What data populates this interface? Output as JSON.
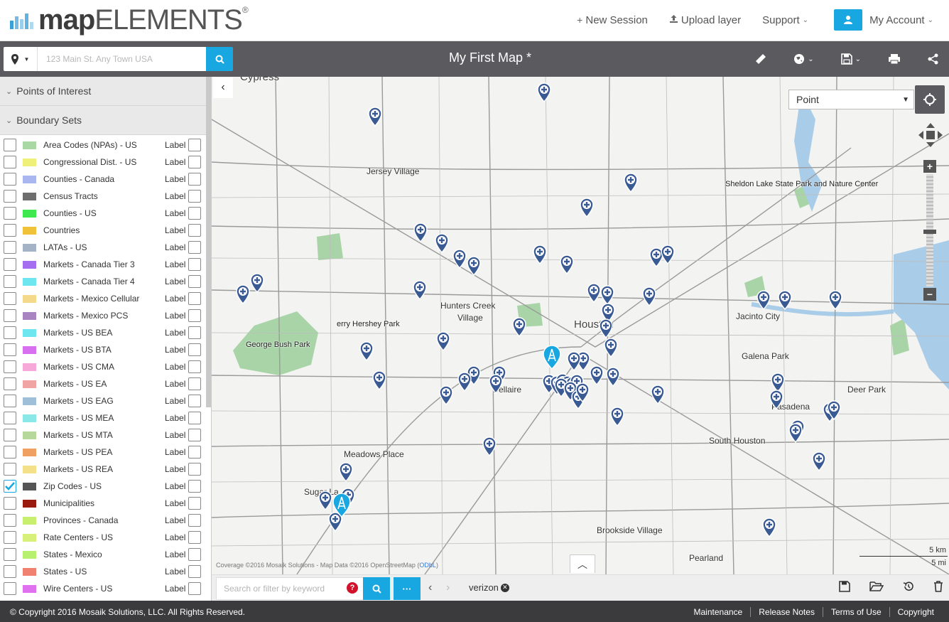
{
  "brand": {
    "name_bold": "map",
    "name_thin": "ELEMENTS",
    "reg": "®"
  },
  "top_nav": {
    "new_session": "New Session",
    "upload_layer": "Upload layer",
    "support": "Support",
    "my_account": "My Account"
  },
  "toolbar": {
    "address_placeholder": "123 Main St. Any Town USA",
    "map_title": "My First Map  *"
  },
  "sidebar": {
    "points_of_interest": "Points of Interest",
    "boundary_sets": "Boundary Sets",
    "label_text": "Label",
    "layers": [
      {
        "name": "Area Codes (NPAs) - US",
        "color": "#a9d8a4",
        "checked": false
      },
      {
        "name": "Congressional Dist. - US",
        "color": "#eef07a",
        "checked": false
      },
      {
        "name": "Counties - Canada",
        "color": "#a9b6f0",
        "checked": false
      },
      {
        "name": "Census Tracts",
        "color": "#6e6e6e",
        "checked": false
      },
      {
        "name": "Counties - US",
        "color": "#3ee84e",
        "checked": false
      },
      {
        "name": "Countries",
        "color": "#f0c23a",
        "checked": false
      },
      {
        "name": "LATAs - US",
        "color": "#a4b4c6",
        "checked": false
      },
      {
        "name": "Markets - Canada Tier 3",
        "color": "#a56ef0",
        "checked": false
      },
      {
        "name": "Markets - Canada Tier 4",
        "color": "#6ee6f0",
        "checked": false
      },
      {
        "name": "Markets - Mexico Cellular",
        "color": "#f5d98a",
        "checked": false
      },
      {
        "name": "Markets - Mexico PCS",
        "color": "#a885c0",
        "checked": false
      },
      {
        "name": "Markets - US BEA",
        "color": "#6ee6f0",
        "checked": false
      },
      {
        "name": "Markets - US BTA",
        "color": "#d86ef0",
        "checked": false
      },
      {
        "name": "Markets - US CMA",
        "color": "#f7a8d8",
        "checked": false
      },
      {
        "name": "Markets - US EA",
        "color": "#f0a4a4",
        "checked": false
      },
      {
        "name": "Markets - US EAG",
        "color": "#9fbfd8",
        "checked": false
      },
      {
        "name": "Markets - US MEA",
        "color": "#8ae8e8",
        "checked": false
      },
      {
        "name": "Markets - US MTA",
        "color": "#b6d89a",
        "checked": false
      },
      {
        "name": "Markets - US PEA",
        "color": "#f0a060",
        "checked": false
      },
      {
        "name": "Markets - US REA",
        "color": "#f5e08a",
        "checked": false
      },
      {
        "name": "Zip Codes - US",
        "color": "#555555",
        "checked": true
      },
      {
        "name": "Municipalities",
        "color": "#9a1a10",
        "checked": false
      },
      {
        "name": "Provinces - Canada",
        "color": "#c8f06e",
        "checked": false
      },
      {
        "name": "Rate Centers - US",
        "color": "#d6f07a",
        "checked": false
      },
      {
        "name": "States - Mexico",
        "color": "#b6f06e",
        "checked": false
      },
      {
        "name": "States - US",
        "color": "#f08070",
        "checked": false
      },
      {
        "name": "Wire Centers - US",
        "color": "#e070f0",
        "checked": false
      }
    ]
  },
  "map": {
    "draw_mode": "Point",
    "attribution": "Coverage ©2016 Mosaik Solutions - Map Data ©2016 OpenStreetMap (",
    "attribution_link": "ODbL",
    "attribution_end": ")",
    "scale_km": "5 km",
    "scale_mi": "5 mi",
    "labels": [
      {
        "text": "Cypress",
        "cls": "big"
      },
      {
        "text": "Jersey Village",
        "cls": ""
      },
      {
        "text": "Sheldon Lake State Park and Nature Center",
        "cls": "park"
      },
      {
        "text": "Hunters Creek",
        "cls": ""
      },
      {
        "text": "Village",
        "cls": ""
      },
      {
        "text": "erry Hershey Park",
        "cls": "park"
      },
      {
        "text": "George Bush Park",
        "cls": "park"
      },
      {
        "text": "Houston",
        "cls": "big"
      },
      {
        "text": "Jacinto City",
        "cls": ""
      },
      {
        "text": "Galena Park",
        "cls": ""
      },
      {
        "text": "Bellaire",
        "cls": ""
      },
      {
        "text": "Deer Park",
        "cls": ""
      },
      {
        "text": "Pasadena",
        "cls": ""
      },
      {
        "text": "Meadows Place",
        "cls": ""
      },
      {
        "text": "South Houston",
        "cls": ""
      },
      {
        "text": "Sugar La",
        "cls": ""
      },
      {
        "text": "Brookside Village",
        "cls": ""
      },
      {
        "text": "Pearland",
        "cls": ""
      }
    ]
  },
  "bottom_bar": {
    "filter_placeholder": "Search or filter by keyword",
    "help": "?",
    "more": "···",
    "tag": "verizon"
  },
  "footer": {
    "copyright": "© Copyright 2016  Mosaik Solutions, LLC.  All Rights Reserved.",
    "links": [
      "Maintenance",
      "Release Notes",
      "Terms of Use",
      "Copyright"
    ]
  }
}
